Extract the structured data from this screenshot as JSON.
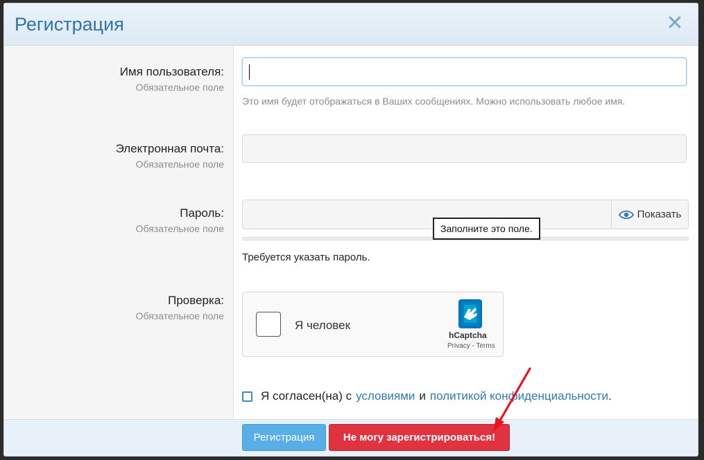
{
  "dialog": {
    "title": "Регистрация",
    "close_label": "✕"
  },
  "fields": {
    "username": {
      "label": "Имя пользователя:",
      "required": "Обязательное поле",
      "value": "",
      "hint": "Это имя будет отображаться в Ваших сообщениях. Можно использовать любое имя."
    },
    "email": {
      "label": "Электронная почта:",
      "required": "Обязательное поле",
      "value": ""
    },
    "password": {
      "label": "Пароль:",
      "required": "Обязательное поле",
      "value": "",
      "show_label": "Показать",
      "tooltip": "Заполните это поле.",
      "message": "Требуется указать пароль."
    },
    "verification": {
      "label": "Проверка:",
      "required": "Обязательное поле",
      "captcha_text": "Я человек",
      "captcha_brand": "hCaptcha",
      "captcha_links": "Privacy - Terms"
    }
  },
  "agreement": {
    "prefix": "Я согласен(на) с",
    "terms_link": "условиями",
    "conj": "и",
    "privacy_link": "политикой конфиденциальности",
    "suffix": "."
  },
  "footer": {
    "register_label": "Регистрация",
    "cant_register_label": "Не могу зарегистрироваться!"
  },
  "colors": {
    "accent": "#2f73ad",
    "danger": "#e0333f",
    "primary_button": "#5aaee6"
  }
}
